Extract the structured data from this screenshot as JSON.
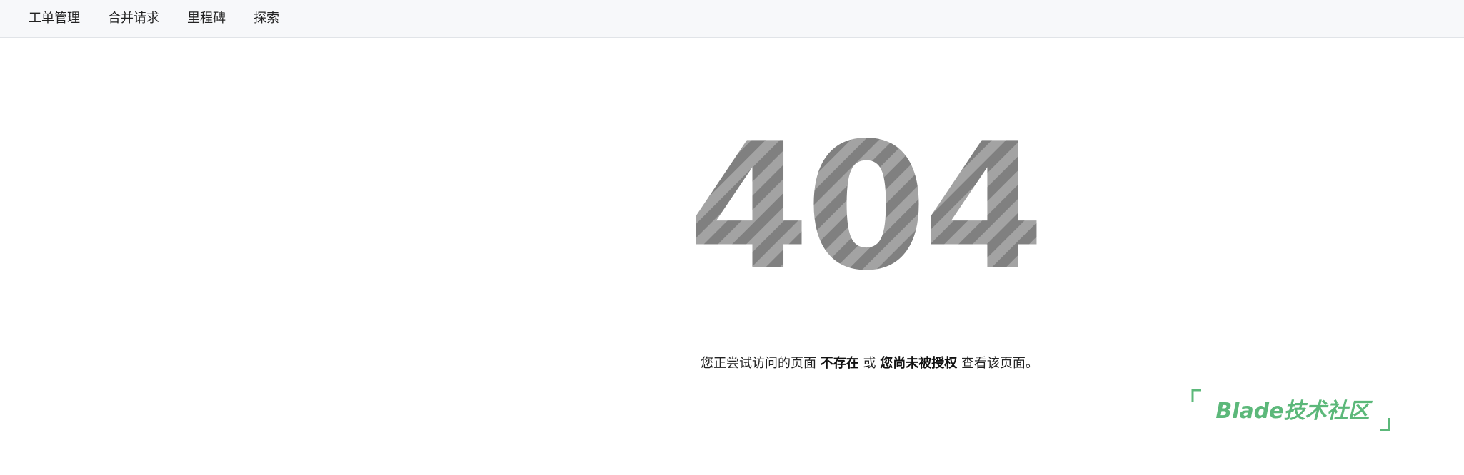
{
  "nav": {
    "items": [
      {
        "label": "工单管理"
      },
      {
        "label": "合并请求"
      },
      {
        "label": "里程碑"
      },
      {
        "label": "探索"
      }
    ]
  },
  "error": {
    "code": "404",
    "message_prefix": "您正尝试访问的页面",
    "message_strong1": "不存在",
    "message_middle": "或",
    "message_strong2": "您尚未被授权",
    "message_suffix": "查看该页面。"
  },
  "logo": {
    "text": "Blade技术社区"
  },
  "colors": {
    "stripe_light": "#a3a3a3",
    "stripe_dark": "#808080",
    "logo_green": "#5cb87a",
    "topbar_bg": "#f7f8fa"
  }
}
